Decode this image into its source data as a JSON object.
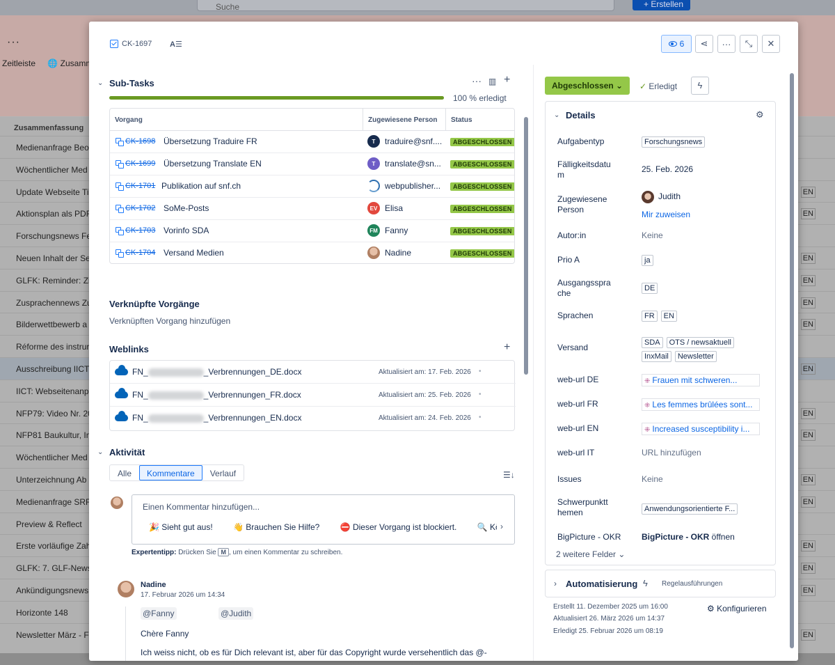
{
  "background": {
    "search_placeholder": "Suche",
    "create_label": "Erstellen",
    "tabs": [
      "Zeitleiste",
      "Zusamm"
    ],
    "column_header": "Zusammenfassung",
    "rows": [
      {
        "text": "Medienanfrage Beob",
        "right": ""
      },
      {
        "text": "Wöchentlicher Med",
        "right": ""
      },
      {
        "text": "Update Webseite Ti",
        "right": "EN"
      },
      {
        "text": "Aktionsplan als PDF",
        "right": "EN"
      },
      {
        "text": "Forschungsnews Fe",
        "right": ""
      },
      {
        "text": "Neuen Inhalt der Se",
        "right": "EN"
      },
      {
        "text": "GLFK: Reminder: Zi",
        "right": "EN"
      },
      {
        "text": "Zusprachennews Zu",
        "right": "EN"
      },
      {
        "text": "Bilderwettbewerb a",
        "right": "EN"
      },
      {
        "text": "Réforme des instrur",
        "right": ""
      },
      {
        "text": "Ausschreibung IICT",
        "right": "EN"
      },
      {
        "text": "IICT: Webseitenanp",
        "right": ""
      },
      {
        "text": "NFP79: Video Nr. 20",
        "right": "EN"
      },
      {
        "text": "NFP81 Baukultur, Int",
        "right": "EN"
      },
      {
        "text": "Wöchentlicher Med",
        "right": ""
      },
      {
        "text": "Unterzeichnung Ab",
        "right": "EN"
      },
      {
        "text": "Medienanfrage SRF",
        "right": "EN"
      },
      {
        "text": "Preview & Reflect",
        "right": ""
      },
      {
        "text": "Erste vorläufige Zah",
        "right": "EN"
      },
      {
        "text": "GLFK: 7. GLF-News:",
        "right": "EN"
      },
      {
        "text": "Ankündigungsnews",
        "right": "EN"
      },
      {
        "text": "Horizonte 148",
        "right": ""
      },
      {
        "text": "Newsletter März - F",
        "right": "EN"
      }
    ]
  },
  "header": {
    "issue_key": "CK-1697",
    "watch_count": "6"
  },
  "subtasks": {
    "title": "Sub-Tasks",
    "progress_percent": 100,
    "progress_label": "100 % erledigt",
    "columns": [
      "Vorgang",
      "Zugewiesene Person",
      "Status"
    ],
    "rows": [
      {
        "key": "CK-1698",
        "summary": "Übersetzung Traduire FR",
        "avatar": "T",
        "avatar_color": "#172b4d",
        "assignee": "traduire@snf....",
        "status": "ABGESCHLOSSEN"
      },
      {
        "key": "CK-1699",
        "summary": "Übersetzung Translate EN",
        "avatar": "T",
        "avatar_color": "#6e5dc6",
        "assignee": "translate@sn...",
        "status": "ABGESCHLOSSEN"
      },
      {
        "key": "CK-1701",
        "summary": "Publikation auf snf.ch",
        "avatar": "",
        "avatar_color": "#ffffff",
        "assignee": "webpublisher...",
        "status": "ABGESCHLOSSEN"
      },
      {
        "key": "CK-1702",
        "summary": "SoMe-Posts",
        "avatar": "EV",
        "avatar_color": "#e2483d",
        "assignee": "Elisa",
        "status": "ABGESCHLOSSEN"
      },
      {
        "key": "CK-1703",
        "summary": "Vorinfo SDA",
        "avatar": "FM",
        "avatar_color": "#1f845a",
        "assignee": "Fanny",
        "status": "ABGESCHLOSSEN"
      },
      {
        "key": "CK-1704",
        "summary": "Versand Medien",
        "avatar": "",
        "avatar_color": "#d9b7a0",
        "assignee": "Nadine",
        "status": "ABGESCHLOSSEN"
      }
    ]
  },
  "linked": {
    "title": "Verknüpfte Vorgänge",
    "add_label": "Verknüpften Vorgang hinzufügen"
  },
  "weblinks": {
    "title": "Weblinks",
    "items": [
      {
        "prefix": "FN_",
        "suffix": "_Verbrennungen_DE.docx",
        "updated": "Aktualisiert am: 17. Feb. 2026"
      },
      {
        "prefix": "FN_",
        "suffix": "_Verbrennungen_FR.docx",
        "updated": "Aktualisiert am: 25. Feb. 2026"
      },
      {
        "prefix": "FN_",
        "suffix": "_Verbrennungen_EN.docx",
        "updated": "Aktualisiert am: 24. Feb. 2026"
      }
    ]
  },
  "activity": {
    "title": "Aktivität",
    "tabs": [
      "Alle",
      "Kommentare",
      "Verlauf"
    ],
    "active_tab": "Kommentare",
    "comment_placeholder": "Einen Kommentar hinzufügen...",
    "quick_replies": [
      "🎉 Sieht gut aus!",
      "👋 Brauchen Sie Hilfe?",
      "⛔ Dieser Vorgang ist blockiert.",
      "🔍 Kön"
    ],
    "tip_bold": "Expertentipp:",
    "tip_pre": " Drücken Sie ",
    "tip_key": "M",
    "tip_post": ", um einen Kommentar zu schreiben.",
    "comment": {
      "author": "Nadine",
      "date": "17. Februar 2026 um 14:34",
      "mentions": [
        "@Fanny",
        "@Judith"
      ],
      "greeting": "Chère Fanny",
      "body": "Ich weiss nicht, ob es für Dich relevant ist, aber für das Copyright wurde versehentlich das @-Zeichen verwendet und nicht das ©-Zeichen . Ich habe das in den Word-Dokumenten nun korrigiert."
    }
  },
  "status": {
    "label": "Abgeschlossen",
    "resolution": "Erledigt"
  },
  "details": {
    "title": "Details",
    "fields": {
      "aufgabentyp_label": "Aufgabentyp",
      "aufgabentyp_value": "Forschungsnews",
      "faellig_label": "Fälligkeitsdatu\nm",
      "faellig_value": "25. Feb. 2026",
      "zugewiesen_label": "Zugewiesene Person",
      "zugewiesen_value": "Judith",
      "zuweisen_link": "Mir zuweisen",
      "autor_label": "Autor:in",
      "autor_value": "Keine",
      "prio_label": "Prio A",
      "prio_value": "ja",
      "ausgang_label": "Ausgangsspra\nche",
      "ausgang_value": "DE",
      "sprachen_label": "Sprachen",
      "sprachen_values": [
        "FR",
        "EN"
      ],
      "versand_label": "Versand",
      "versand_values": [
        "SDA",
        "OTS / newsaktuell",
        "InxMail",
        "Newsletter"
      ],
      "url_de_label": "web-url DE",
      "url_de_value": "Frauen mit schweren...",
      "url_fr_label": "web-url FR",
      "url_fr_value": "Les femmes brûlées sont...",
      "url_en_label": "web-url EN",
      "url_en_value": "Increased susceptibility i...",
      "url_it_label": "web-url IT",
      "url_it_value": "URL hinzufügen",
      "issues_label": "Issues",
      "issues_value": "Keine",
      "schwerpunkt_label": "Schwerpunktt\nhemen",
      "schwerpunkt_value": "Anwendungsorientierte F...",
      "bigpicture_label": "BigPicture - OKR",
      "bigpicture_bold": "BigPicture - OKR",
      "bigpicture_rest": " öffnen"
    },
    "more_fields": "2 weitere Felder"
  },
  "automation": {
    "title": "Automatisierung",
    "rules": "Regelausführungen"
  },
  "meta": {
    "created": "Erstellt 11. Dezember 2025 um 16:00",
    "updated": "Aktualisiert 26. März 2026 um 14:37",
    "resolved": "Erledigt 25. Februar 2026 um 08:19",
    "configure": "Konfigurieren"
  }
}
